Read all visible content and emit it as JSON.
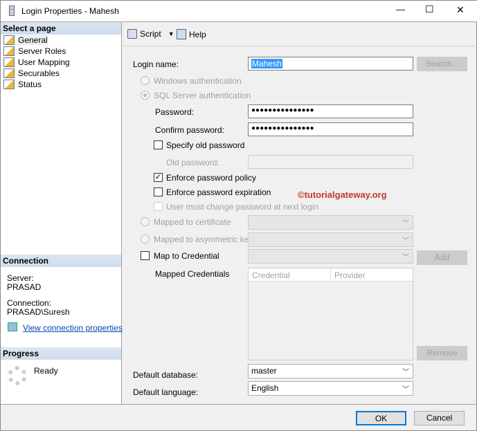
{
  "window": {
    "title": "Login Properties - Mahesh",
    "minimize": "—",
    "maximize": "☐",
    "close": "✕"
  },
  "sidebar": {
    "select_header": "Select a page",
    "pages": [
      "General",
      "Server Roles",
      "User Mapping",
      "Securables",
      "Status"
    ],
    "connection_header": "Connection",
    "server_label": "Server:",
    "server_value": "PRASAD",
    "connection_label": "Connection:",
    "connection_value": "PRASAD\\Suresh",
    "view_link": "View connection properties",
    "progress_header": "Progress",
    "progress_status": "Ready"
  },
  "toolbar": {
    "script": "Script",
    "help": "Help"
  },
  "form": {
    "login_name_label": "Login name:",
    "login_name_value": "Mahesh",
    "search_button": "Search...",
    "windows_auth": "Windows authentication",
    "sql_auth": "SQL Server authentication",
    "password_label": "Password:",
    "password_value": "●●●●●●●●●●●●●●●",
    "confirm_label": "Confirm password:",
    "confirm_value": "●●●●●●●●●●●●●●●",
    "specify_old": "Specify old password",
    "old_password_label": "Old password:",
    "enforce_policy": "Enforce password policy",
    "enforce_expiration": "Enforce password expiration",
    "must_change": "User must change password at next login",
    "mapped_cert": "Mapped to certificate",
    "mapped_asym": "Mapped to asymmetric key",
    "map_credential": "Map to Credential",
    "add_button": "Add",
    "mapped_credentials_label": "Mapped Credentials",
    "grid_headers": [
      "Credential",
      "Provider"
    ],
    "remove_button": "Remove",
    "default_db_label": "Default database:",
    "default_db_value": "master",
    "default_lang_label": "Default language:",
    "default_lang_value": "English"
  },
  "watermark": "©tutorialgateway.org",
  "footer": {
    "ok": "OK",
    "cancel": "Cancel"
  }
}
